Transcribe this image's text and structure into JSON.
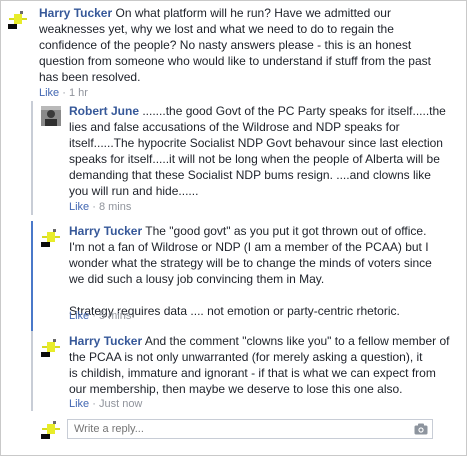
{
  "comments": [
    {
      "author": "Harry Tucker",
      "text": "On what platform will he run? Have we admitted our\nweaknesses yet, why we lost and what we need to do to regain the\nconfidence of the people? No nasty answers please - this is an honest\nquestion from someone who would like to understand if stuff from the past\nhas been resolved.",
      "like_label": "Like",
      "separator": " · ",
      "time": "1 hr"
    },
    {
      "author": "Robert June",
      "text": " .......the good Govt of the PC Party speaks for itself.....the\nlies and false accusations of the Wildrose and NDP speaks for\nitself......The hypocrite Socialist NDP Govt behavour since last election\nspeaks for itself.....it will not be long when the people of Alberta will be\ndemanding that these Socialist NDP bums resign. ....and clowns like\nyou will run and hide......",
      "like_label": "Like",
      "separator": " · ",
      "time": "8 mins"
    },
    {
      "author": "Harry Tucker",
      "text": " The \"good govt\" as you put it got thrown out of office.\nI'm not a fan of Wildrose or NDP (I am a member of the PCAA) but I\nwonder what the strategy will be to change the minds of voters since\nwe did such a lousy job convincing them in May.\n\nStrategy requires data .... not emotion or party-centric rhetoric.",
      "like_label": "Like",
      "separator": " · ",
      "time": "5 mins"
    },
    {
      "author": "Harry Tucker",
      "text": " And the comment \"clowns like you\" to a fellow member of\nthe PCAA is not only unwarranted (for merely asking a question), it\nis childish, immature and ignorant - if that is what we can expect from\nour membership, then maybe we deserve to lose this one also.",
      "like_label": "Like",
      "separator": " · ",
      "time": "Just now"
    }
  ],
  "reply": {
    "placeholder": "Write a reply..."
  },
  "icons": {
    "camera": "camera-icon"
  },
  "colors": {
    "link": "#365899",
    "like": "#4267b2",
    "meta": "#90949c",
    "highlight_rule": "#4a78c9"
  }
}
